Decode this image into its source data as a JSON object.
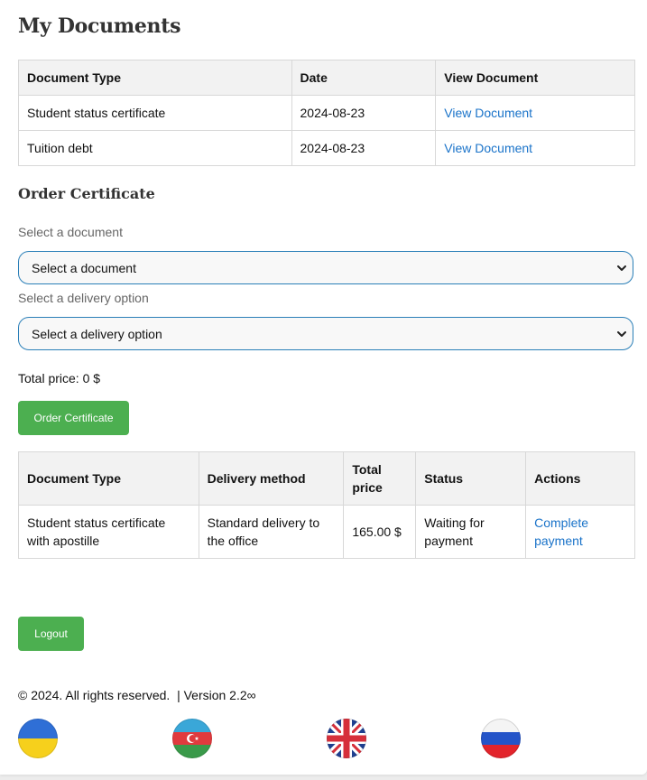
{
  "page": {
    "title": "My Documents"
  },
  "documents_table": {
    "headers": [
      "Document Type",
      "Date",
      "View Document"
    ],
    "rows": [
      {
        "type": "Student status certificate",
        "date": "2024-08-23",
        "link": "View Document"
      },
      {
        "type": "Tuition debt",
        "date": "2024-08-23",
        "link": "View Document"
      }
    ]
  },
  "order": {
    "title": "Order Certificate",
    "document_label": "Select a document",
    "document_value": "Select a document",
    "delivery_label": "Select a delivery option",
    "delivery_value": "Select a delivery option",
    "total_price": "Total price: 0 $",
    "button": "Order Certificate"
  },
  "orders_table": {
    "headers": [
      "Document Type",
      "Delivery method",
      "Total price",
      "Status",
      "Actions"
    ],
    "rows": [
      {
        "type": "Student status certificate with apostille",
        "delivery": "Standard delivery to the office",
        "price": "165.00 $",
        "status": "Waiting for payment",
        "action": "Complete payment"
      }
    ]
  },
  "logout_label": "Logout",
  "footer": {
    "text": "© 2024. All rights reserved.  | Version 2.2∞"
  },
  "languages": [
    "ukrainian-flag-icon",
    "azerbaijani-flag-icon",
    "uk-flag-icon",
    "russian-flag-icon"
  ],
  "colors": {
    "accent": "#4caf50",
    "link": "#1a73c9",
    "select_border": "#2a7fb8"
  }
}
